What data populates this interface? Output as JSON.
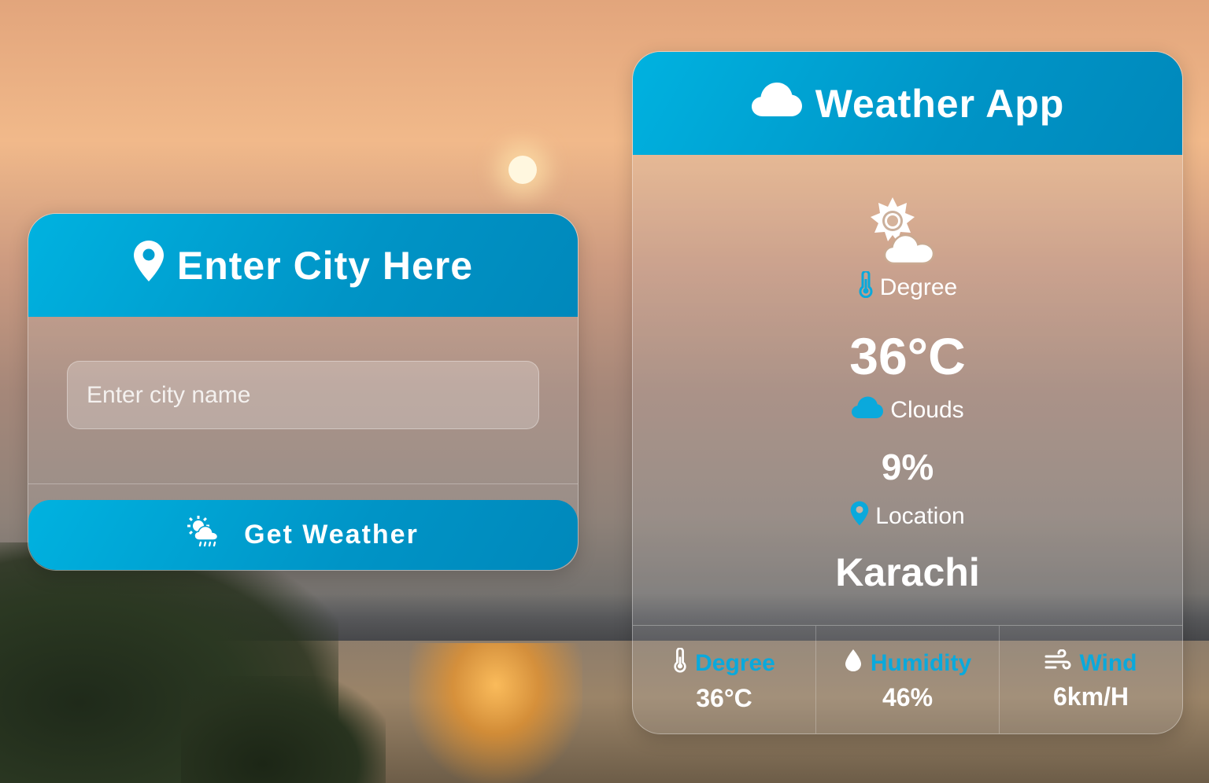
{
  "city_card": {
    "title": "Enter City Here",
    "title_icon": "location-pin-icon",
    "input_placeholder": "Enter city name",
    "input_value": "",
    "button_label": "Get Weather",
    "button_icon": "sun-cloud-rain-icon"
  },
  "weather_card": {
    "title": "Weather App",
    "title_icon": "cloud-icon",
    "condition_icon": "sun-behind-cloud-icon",
    "degree_label": "Degree",
    "degree_value": "36°C",
    "clouds_label": "Clouds",
    "clouds_value": "9%",
    "location_label": "Location",
    "location_value": "Karachi",
    "stats": [
      {
        "label": "Degree",
        "value": "36°C",
        "icon": "thermometer-icon"
      },
      {
        "label": "Humidity",
        "value": "46%",
        "icon": "water-drop-icon"
      },
      {
        "label": "Wind",
        "value": "6km/H",
        "icon": "wind-icon"
      }
    ]
  },
  "colors": {
    "accent": "#00a8da",
    "accent_dark": "#0088bb",
    "text": "#ffffff"
  }
}
